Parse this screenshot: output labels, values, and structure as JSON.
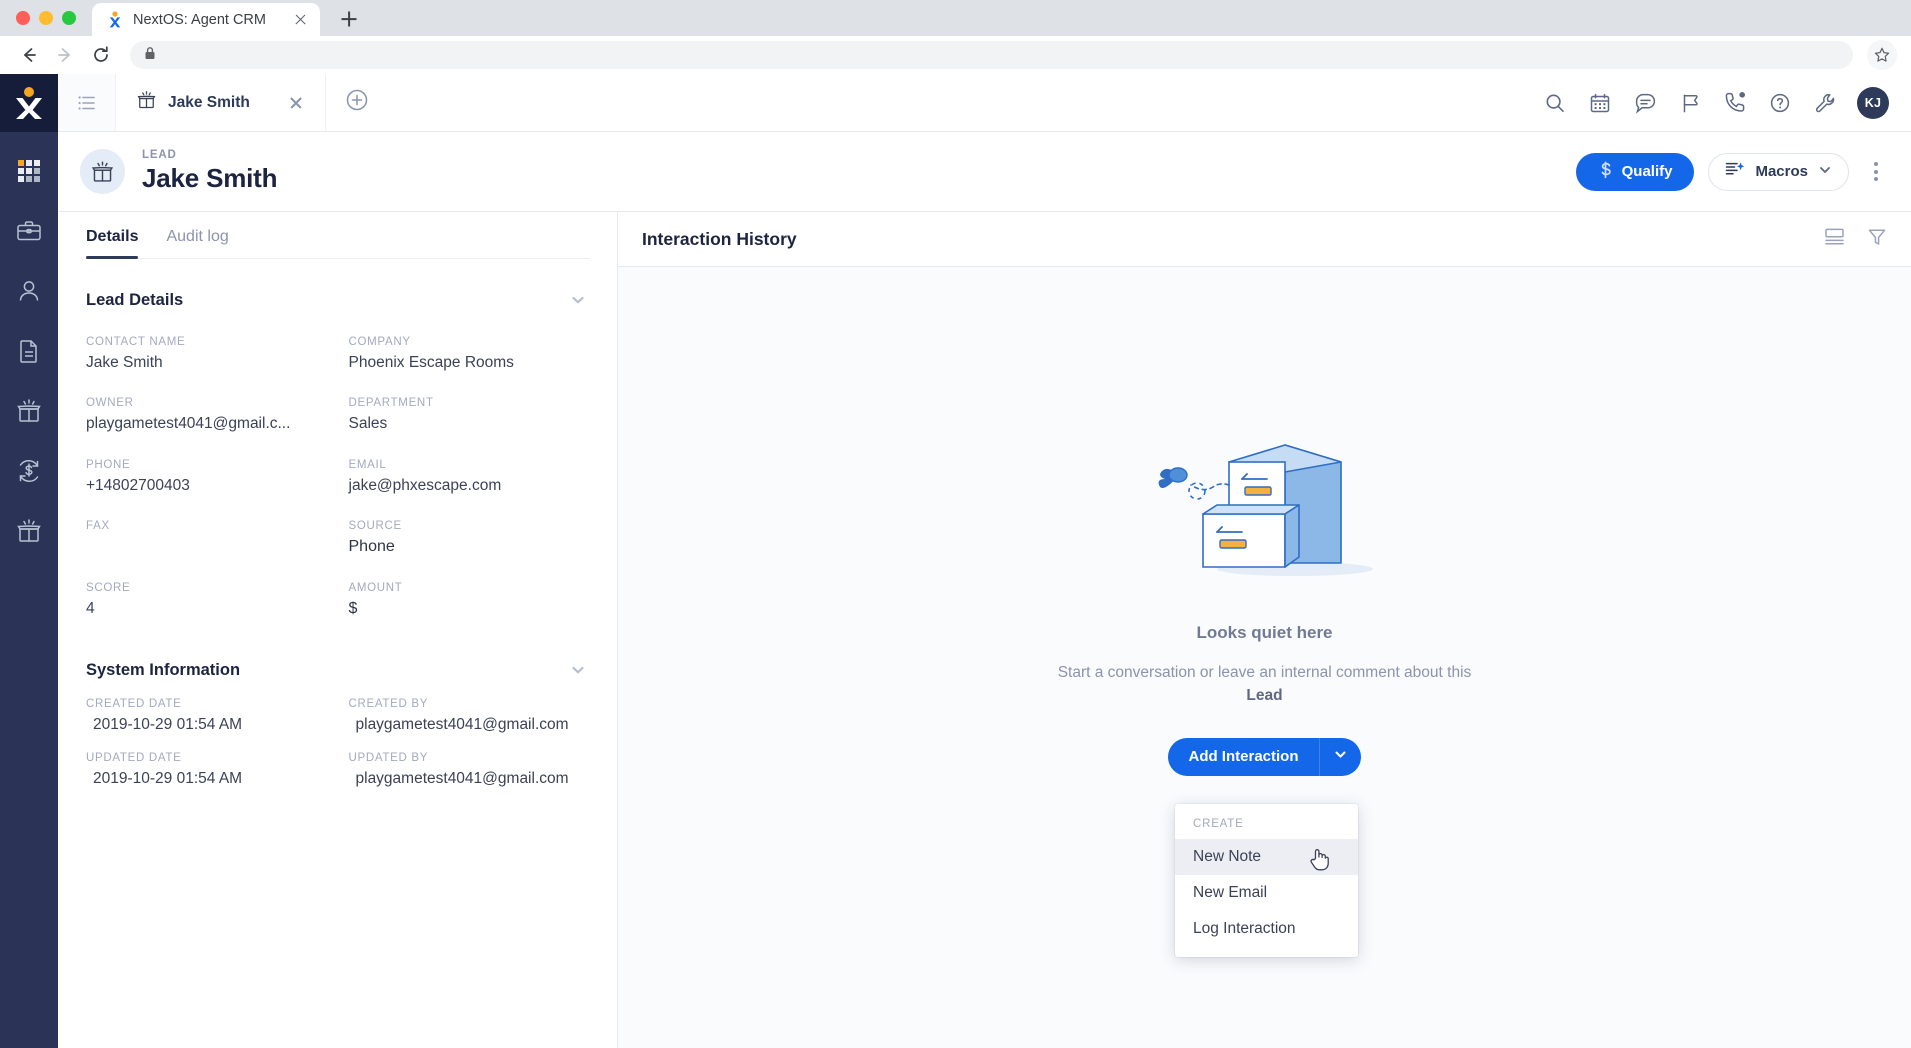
{
  "browser": {
    "tab_title": "NextOS: Agent CRM",
    "favicon": "nextos-x-icon",
    "new_tab_icon": "plus-icon",
    "back_icon": "arrow-left-icon",
    "forward_icon": "arrow-right-icon",
    "reload_icon": "reload-icon",
    "lock_icon": "lock-icon",
    "address_value": "",
    "star_icon": "star-icon"
  },
  "rail": {
    "logo": "nextos-logo",
    "items": [
      {
        "name": "apps-grid-icon"
      },
      {
        "name": "briefcase-icon"
      },
      {
        "name": "person-icon"
      },
      {
        "name": "document-icon"
      },
      {
        "name": "lead-box-icon"
      },
      {
        "name": "deal-dollar-icon"
      },
      {
        "name": "open-box-icon"
      }
    ]
  },
  "app_tabs": {
    "list_toggle_icon": "list-icon",
    "record_tab": {
      "icon": "lead-box-icon",
      "label": "Jake Smith",
      "close_icon": "close-icon"
    },
    "add_tab_icon": "plus-circle-icon"
  },
  "header_icons": [
    {
      "name": "search-icon"
    },
    {
      "name": "calendar-icon"
    },
    {
      "name": "chat-icon"
    },
    {
      "name": "flag-icon"
    },
    {
      "name": "phone-icon",
      "badge": true
    },
    {
      "name": "help-icon"
    },
    {
      "name": "wrench-icon"
    }
  ],
  "avatar": {
    "initials": "KJ"
  },
  "record": {
    "kind": "LEAD",
    "name": "Jake Smith",
    "avatar_icon": "lead-box-icon",
    "qualify_label": "Qualify",
    "qualify_icon": "dollar-icon",
    "qualify_color": "#1467e8",
    "macros_label": "Macros",
    "macros_icon": "macros-icon",
    "macros_caret_icon": "chevron-down-icon",
    "kebab_icon": "more-vertical-icon"
  },
  "details": {
    "tabs": [
      {
        "label": "Details",
        "active": true
      },
      {
        "label": "Audit log",
        "active": false
      }
    ],
    "lead_details": {
      "title": "Lead Details",
      "collapse_icon": "chevron-down-icon",
      "fields": [
        {
          "label": "CONTACT NAME",
          "value": "Jake Smith"
        },
        {
          "label": "COMPANY",
          "value": "Phoenix Escape Rooms"
        },
        {
          "label": "OWNER",
          "value": "playgametest4041@gmail.c..."
        },
        {
          "label": "DEPARTMENT",
          "value": "Sales"
        },
        {
          "label": "PHONE",
          "value": "+14802700403"
        },
        {
          "label": "EMAIL",
          "value": "jake@phxescape.com"
        },
        {
          "label": "FAX",
          "value": ""
        },
        {
          "label": "SOURCE",
          "value": "Phone"
        },
        {
          "label": "SCORE",
          "value": "4"
        },
        {
          "label": "AMOUNT",
          "value": "$"
        }
      ]
    },
    "system_information": {
      "title": "System Information",
      "collapse_icon": "chevron-down-icon",
      "fields": [
        {
          "label": "CREATED DATE",
          "value": "2019-10-29 01:54 AM"
        },
        {
          "label": "CREATED BY",
          "value": "playgametest4041@gmail.com"
        },
        {
          "label": "UPDATED DATE",
          "value": "2019-10-29 01:54 AM"
        },
        {
          "label": "UPDATED BY",
          "value": "playgametest4041@gmail.com"
        }
      ]
    }
  },
  "history": {
    "title": "Interaction History",
    "view_icon": "layout-view-icon",
    "filter_icon": "filter-icon",
    "empty": {
      "illustration": "file-cabinet-illustration",
      "title": "Looks quiet here",
      "subtitle_before": "Start a conversation or leave an internal comment about this ",
      "subtitle_bold": "Lead"
    },
    "add_button": {
      "label": "Add Interaction",
      "caret_icon": "chevron-down-icon"
    },
    "dropdown": {
      "header": "CREATE",
      "items": [
        {
          "label": "New Note",
          "hovered": true
        },
        {
          "label": "New Email",
          "hovered": false
        },
        {
          "label": "Log Interaction",
          "hovered": false
        }
      ]
    }
  },
  "cursor": {
    "icon": "pointing-hand-cursor"
  }
}
